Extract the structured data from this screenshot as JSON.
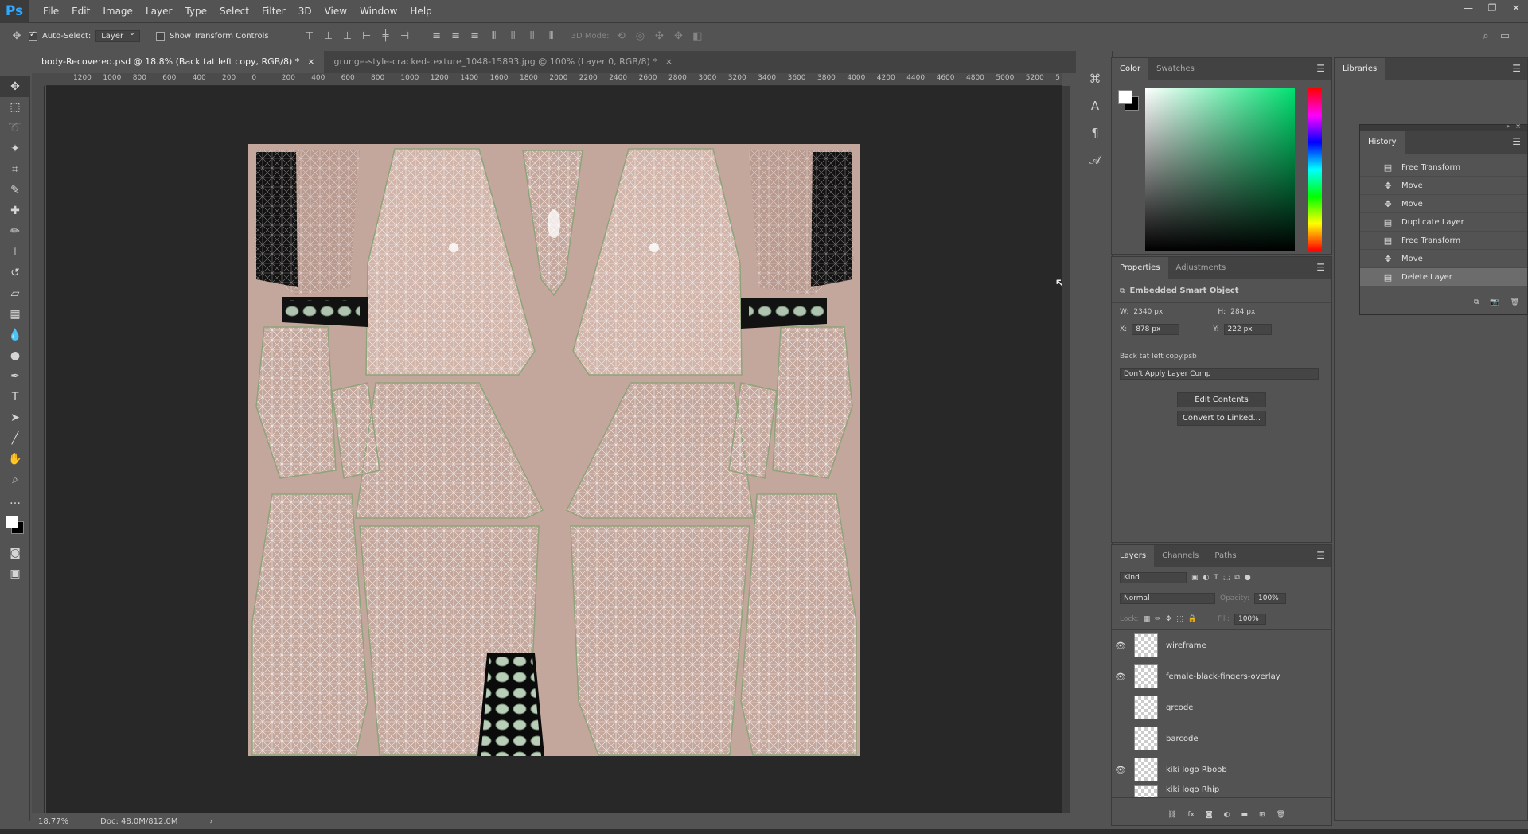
{
  "app": {
    "logo": "Ps"
  },
  "menu": [
    "File",
    "Edit",
    "Image",
    "Layer",
    "Type",
    "Select",
    "Filter",
    "3D",
    "View",
    "Window",
    "Help"
  ],
  "window_controls": {
    "minimize": "—",
    "restore": "❐",
    "close": "✕"
  },
  "options_bar": {
    "auto_select_label": "Auto-Select:",
    "auto_select_checked": true,
    "auto_select_value": "Layer",
    "show_transform_label": "Show Transform Controls",
    "show_transform_checked": false,
    "mode_3d_label": "3D Mode:"
  },
  "documents": [
    {
      "title": "body-Recovered.psd @ 18.8% (Back tat left copy, RGB/8) *",
      "active": true
    },
    {
      "title": "grunge-style-cracked-texture_1048-15893.jpg @ 100% (Layer 0, RGB/8) *",
      "active": false
    }
  ],
  "ruler_h_labels": [
    "1200",
    "1000",
    "800",
    "600",
    "400",
    "200",
    "0",
    "200",
    "400",
    "600",
    "800",
    "1000",
    "1200",
    "1400",
    "1600",
    "1800",
    "2000",
    "2200",
    "2400",
    "2600",
    "2800",
    "3000",
    "3200",
    "3400",
    "3600",
    "3800",
    "4000",
    "4200",
    "4400",
    "4600",
    "4800",
    "5000",
    "5200",
    "5"
  ],
  "status": {
    "zoom": "18.77%",
    "doc": "Doc: 48.0M/812.0M"
  },
  "color_panel": {
    "tabs": [
      "Color",
      "Swatches"
    ],
    "foreground": "#ffffff",
    "background": "#000000",
    "hue": "#00e070"
  },
  "properties": {
    "tabs": [
      "Properties",
      "Adjustments"
    ],
    "type": "Embedded Smart Object",
    "w_label": "W:",
    "w": "2340 px",
    "h_label": "H:",
    "h": "284 px",
    "x_label": "X:",
    "x": "878 px",
    "y_label": "Y:",
    "y": "222 px",
    "source": "Back tat left copy.psb",
    "layer_comp": "Don't Apply Layer Comp",
    "edit_contents": "Edit Contents",
    "convert_linked": "Convert to Linked..."
  },
  "layers_panel": {
    "tabs": [
      "Layers",
      "Channels",
      "Paths"
    ],
    "filter": "Kind",
    "blend_mode": "Normal",
    "opacity_label": "Opacity:",
    "opacity": "100%",
    "lock_label": "Lock:",
    "fill_label": "Fill:",
    "fill": "100%",
    "layers": [
      {
        "name": "wireframe",
        "visible": true
      },
      {
        "name": "female-black-fingers-overlay",
        "visible": true
      },
      {
        "name": "qrcode",
        "visible": false
      },
      {
        "name": "barcode",
        "visible": false
      },
      {
        "name": "kiki logo Rboob",
        "visible": true
      },
      {
        "name": "kiki logo Rhip",
        "visible": false
      }
    ]
  },
  "libraries": {
    "title": "Libraries"
  },
  "history": {
    "title": "History",
    "items": [
      {
        "name": "Free Transform",
        "icon": "document-icon"
      },
      {
        "name": "Move",
        "icon": "move-icon"
      },
      {
        "name": "Move",
        "icon": "move-icon"
      },
      {
        "name": "Duplicate Layer",
        "icon": "document-icon"
      },
      {
        "name": "Free Transform",
        "icon": "document-icon"
      },
      {
        "name": "Move",
        "icon": "move-icon"
      },
      {
        "name": "Delete Layer",
        "icon": "document-icon",
        "selected": true
      }
    ]
  }
}
